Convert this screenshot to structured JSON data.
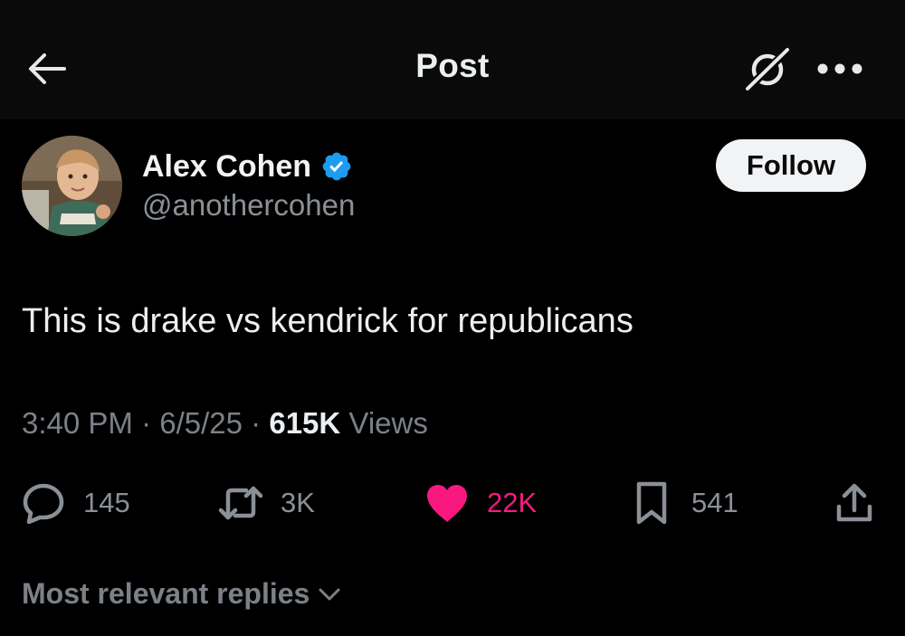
{
  "header": {
    "title": "Post",
    "back_icon": "arrow-left-icon",
    "grok_icon": "grok-icon",
    "more_icon": "more-horizontal-icon"
  },
  "author": {
    "display_name": "Alex Cohen",
    "handle": "@anothercohen",
    "verified": true,
    "verified_color": "#1d9bf0"
  },
  "follow_button": {
    "label": "Follow"
  },
  "post": {
    "text": "This is drake vs kendrick for republicans",
    "time": "3:40 PM",
    "date": "6/5/25",
    "views_count": "615K",
    "views_label": "Views",
    "separator": "·"
  },
  "actions": {
    "replies": {
      "count": "145",
      "icon": "reply-icon"
    },
    "reposts": {
      "count": "3K",
      "icon": "repost-icon"
    },
    "likes": {
      "count": "22K",
      "icon": "heart-filled-icon",
      "color": "#f91880"
    },
    "bookmarks": {
      "count": "541",
      "icon": "bookmark-icon"
    },
    "share": {
      "icon": "share-icon"
    }
  },
  "replies_sort": {
    "label": "Most relevant replies",
    "icon": "chevron-down-icon"
  },
  "colors": {
    "background": "#000000",
    "header_background": "#0a0a0a",
    "primary_text": "#e7e9ea",
    "secondary_text": "#8b9096",
    "like_pink": "#f91880"
  }
}
